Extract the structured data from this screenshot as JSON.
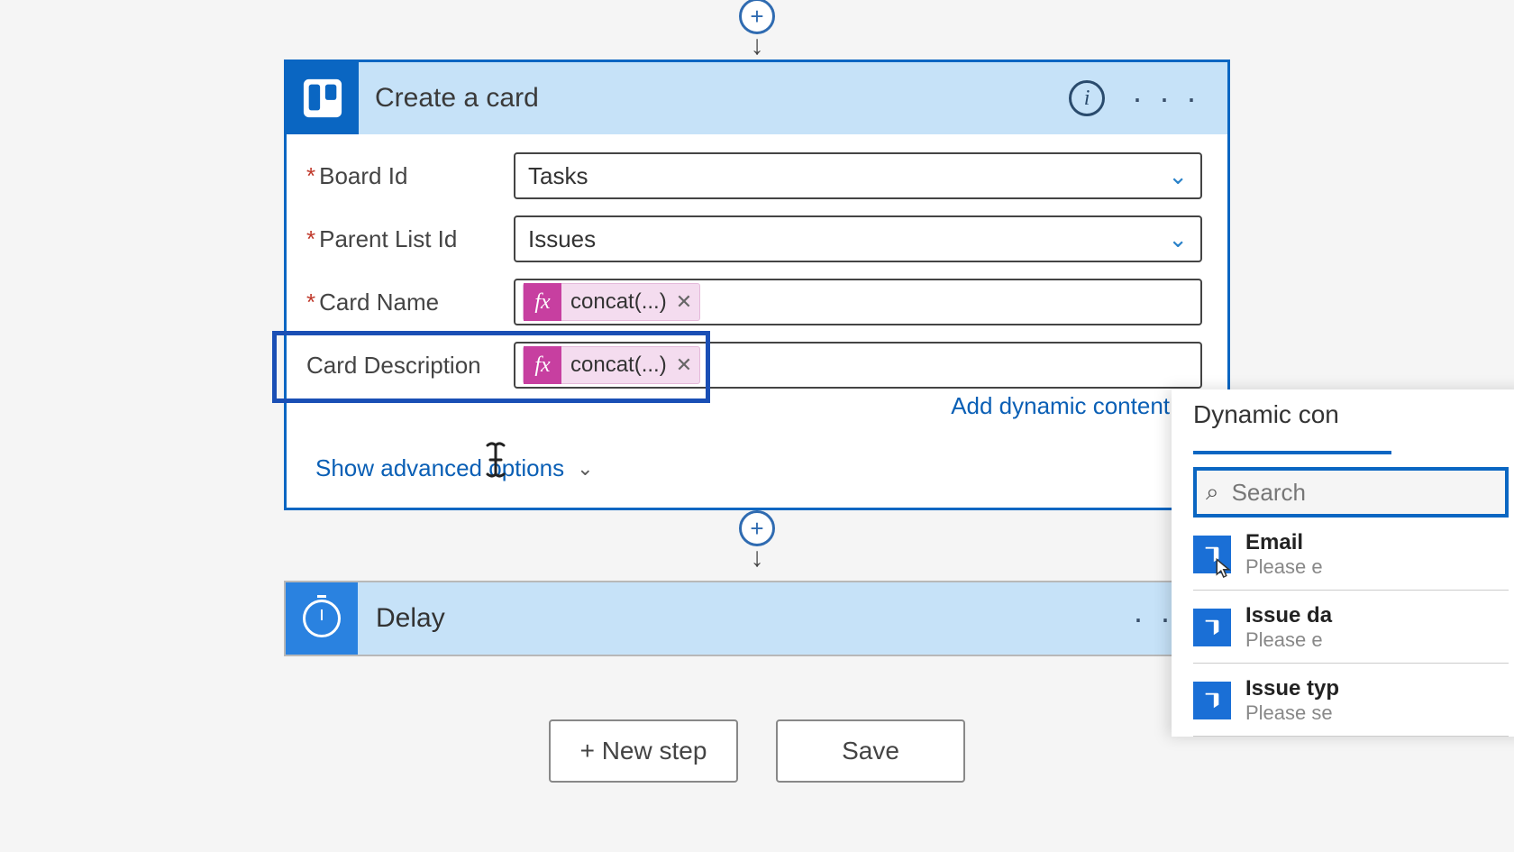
{
  "action": {
    "title": "Create a card",
    "fields": {
      "board": {
        "label": "Board Id",
        "value": "Tasks",
        "required": true
      },
      "parentList": {
        "label": "Parent List Id",
        "value": "Issues",
        "required": true
      },
      "cardName": {
        "label": "Card Name",
        "token": "concat(...)",
        "required": true
      },
      "cardDesc": {
        "label": "Card Description",
        "token": "concat(...)",
        "required": false
      }
    },
    "addDynamic": "Add dynamic content",
    "showAdvanced": "Show advanced options"
  },
  "delay": {
    "title": "Delay"
  },
  "footer": {
    "newStep": "+ New step",
    "save": "Save"
  },
  "dynamicPanel": {
    "heading": "Dynamic con",
    "searchPlaceholder": "Search",
    "items": [
      {
        "title": "Email",
        "sub": "Please e"
      },
      {
        "title": "Issue da",
        "sub": "Please e"
      },
      {
        "title": "Issue typ",
        "sub": "Please se"
      }
    ]
  }
}
